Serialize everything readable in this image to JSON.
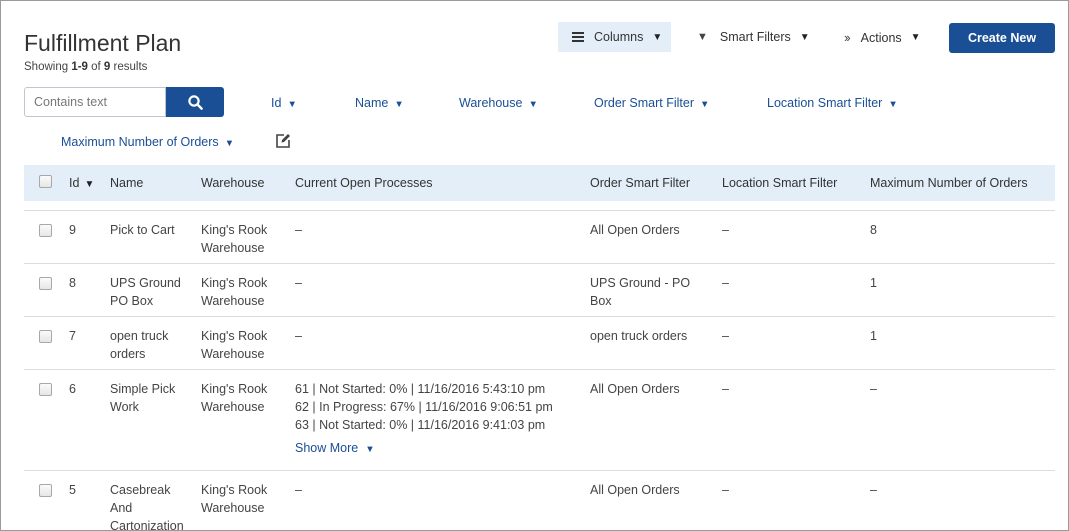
{
  "header": {
    "title": "Fulfillment Plan",
    "showing_prefix": "Showing ",
    "showing_range": "1-9",
    "showing_of": " of ",
    "showing_total": "9",
    "showing_suffix": " results"
  },
  "toolbar": {
    "columns_label": "Columns",
    "smart_filters_label": "Smart Filters",
    "actions_label": "Actions",
    "create_label": "Create New"
  },
  "search": {
    "placeholder": "Contains text"
  },
  "filters": [
    "Id",
    "Name",
    "Warehouse",
    "Order Smart Filter",
    "Location Smart Filter",
    "Maximum Number of Orders"
  ],
  "table": {
    "columns": [
      "Id",
      "Name",
      "Warehouse",
      "Current Open Processes",
      "Order Smart Filter",
      "Location Smart Filter",
      "Maximum Number of Orders"
    ],
    "rows": [
      {
        "id": "9",
        "name": [
          "Pick to Cart"
        ],
        "warehouse": [
          "King's Rook",
          "Warehouse"
        ],
        "processes": [
          "–"
        ],
        "show_more": "",
        "order_filter": [
          "All Open Orders"
        ],
        "location_filter": "–",
        "max_orders": "8"
      },
      {
        "id": "8",
        "name": [
          "UPS Ground",
          "PO Box"
        ],
        "warehouse": [
          "King's Rook",
          "Warehouse"
        ],
        "processes": [
          "–"
        ],
        "show_more": "",
        "order_filter": [
          "UPS Ground - PO",
          "Box"
        ],
        "location_filter": "–",
        "max_orders": "1"
      },
      {
        "id": "7",
        "name": [
          "open truck",
          "orders"
        ],
        "warehouse": [
          "King's Rook",
          "Warehouse"
        ],
        "processes": [
          "–"
        ],
        "show_more": "",
        "order_filter": [
          "open truck orders"
        ],
        "location_filter": "–",
        "max_orders": "1"
      },
      {
        "id": "6",
        "name": [
          "Simple Pick",
          "Work"
        ],
        "warehouse": [
          "King's Rook",
          "Warehouse"
        ],
        "processes": [
          "61  |  Not Started: 0%  |  11/16/2016  5:43:10 pm",
          "62  |  In Progress: 67%  |  11/16/2016  9:06:51 pm",
          "63  |  Not Started: 0%  |  11/16/2016  9:41:03 pm"
        ],
        "show_more": "Show More",
        "order_filter": [
          "All Open Orders"
        ],
        "location_filter": "–",
        "max_orders": "–"
      },
      {
        "id": "5",
        "name": [
          "Casebreak",
          "And",
          "Cartonization"
        ],
        "warehouse": [
          "King's Rook",
          "Warehouse"
        ],
        "processes": [
          "–"
        ],
        "show_more": "",
        "order_filter": [
          "All Open Orders"
        ],
        "location_filter": "–",
        "max_orders": "–"
      }
    ]
  },
  "colors": {
    "primary": "#1a4f96",
    "header_bg": "#e3eef8",
    "link": "#1a4f96"
  },
  "icons": [
    "list-icon",
    "funnel-icon",
    "double-chevron-icon",
    "search-icon",
    "edit-icon",
    "caret-down-icon"
  ]
}
